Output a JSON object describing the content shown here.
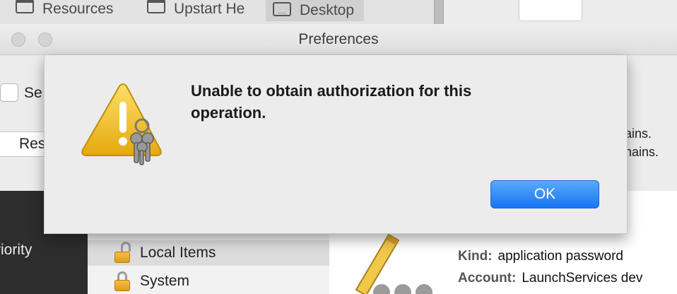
{
  "finder_toolbar": {
    "favorites": [
      "Resources",
      "Upstart He",
      "Desktop"
    ],
    "desktop_icon_glyph": "...."
  },
  "preferences_window": {
    "title": "Preferences",
    "checkbox_label_partial": "Se",
    "reset_button_partial": "Res",
    "note_lines": [
      "ains.",
      "hains."
    ]
  },
  "alert": {
    "message": "Unable to obtain authorization for this operation.",
    "ok_label": "OK",
    "icon": "warning-keys-icon"
  },
  "keychain": {
    "left_label_partial": "riority",
    "sidebar": [
      {
        "label": "Local Items",
        "icon": "unlocked-padlock-icon",
        "selected": true
      },
      {
        "label": "System",
        "icon": "locked-padlock-icon",
        "selected": false
      }
    ],
    "item_name_partial": "<unknown>",
    "detail": {
      "kind_key": "Kind:",
      "kind_value": "application password",
      "account_key": "Account:",
      "account_value": "LaunchServices dev"
    }
  },
  "colors": {
    "ok_button": "#1676f2",
    "warning_yellow": "#f3c21a",
    "sheet_bg": "#ececec"
  }
}
